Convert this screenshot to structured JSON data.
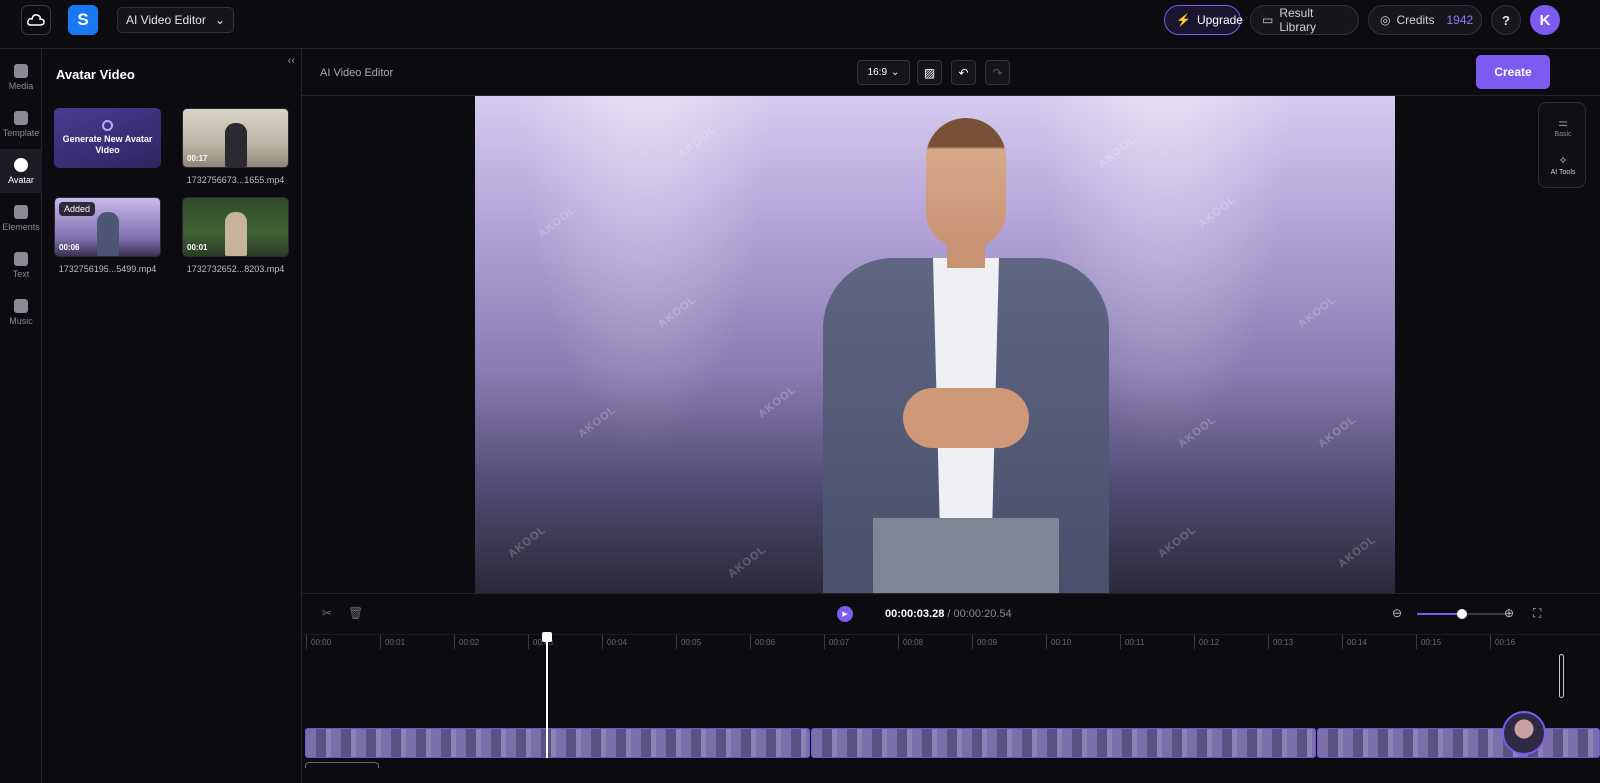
{
  "topbar": {
    "logo_icon": "cloud-logo-icon",
    "workspace_badge": "S",
    "project_select": "AI Video Editor",
    "upgrade_label": "Upgrade",
    "library_label": "Result Library",
    "credits_label": "Credits",
    "credits_value": "1942",
    "help_label": "?",
    "avatar_initial": "K",
    "accent": "#7c5cf0"
  },
  "rail": {
    "items": [
      {
        "label": "Media",
        "icon": "media-icon"
      },
      {
        "label": "Template",
        "icon": "template-icon"
      },
      {
        "label": "Avatar",
        "icon": "avatar-icon",
        "active": true
      },
      {
        "label": "Elements",
        "icon": "elements-icon"
      },
      {
        "label": "Text",
        "icon": "text-icon"
      },
      {
        "label": "Music",
        "icon": "music-icon"
      }
    ]
  },
  "panel": {
    "title": "Avatar Video",
    "collapse": "‹‹",
    "generate_label": "Generate New Avatar Video",
    "assets": [
      {
        "name": "1732756673...1655.mp4",
        "duration": "00:17"
      },
      {
        "name": "1732756195...5499.mp4",
        "duration": "00:06",
        "badge": "Added"
      },
      {
        "name": "1732732652...8203.mp4",
        "duration": "00:01"
      }
    ]
  },
  "editor": {
    "title": "AI Video Editor",
    "ratio": "16:9",
    "create_label": "Create",
    "watermark": "AKOOL",
    "right_tools": [
      {
        "label": "Basic",
        "icon": "sliders-icon"
      },
      {
        "label": "AI Tools",
        "icon": "sparkle-icon"
      }
    ]
  },
  "timeline": {
    "current": "00:00:03.28",
    "separator": " / ",
    "total": "00:00:20.54",
    "zoom_level": 0.5,
    "ticks": [
      "00:00",
      "00:01",
      "00:02",
      "00:03",
      "00:04",
      "00:05",
      "00:06",
      "00:07",
      "00:08",
      "00:09",
      "00:10",
      "00:11",
      "00:12",
      "00:13",
      "00:14",
      "00:15",
      "00:16"
    ]
  }
}
